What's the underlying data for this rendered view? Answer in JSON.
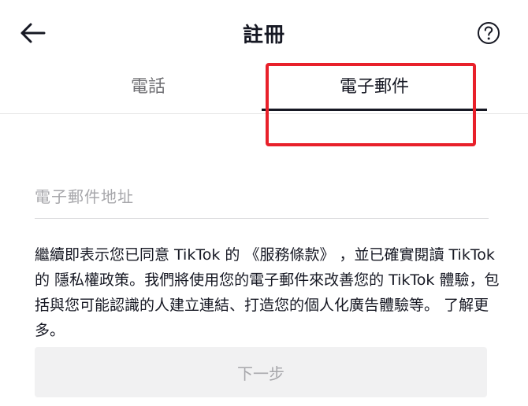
{
  "header": {
    "title": "註冊",
    "back_icon": "arrow-left-icon",
    "help_icon": "question-circle-icon"
  },
  "tabs": [
    {
      "label": "電話",
      "active": false
    },
    {
      "label": "電子郵件",
      "active": true
    }
  ],
  "email": {
    "placeholder": "電子郵件地址",
    "value": ""
  },
  "terms": {
    "part1": "繼續即表示您已同意 TikTok 的 ",
    "terms_link": "《服務條款》",
    "part2": " ，並已確實閱讀 TikTok 的 ",
    "privacy_link": "隱私權政策",
    "part3": "。我們將使用您的電子郵件來改善您的 TikTok 體驗，包括與您可能認識的人建立連結、打造您的個人化廣告體驗等。",
    "learn_more": "了解更多",
    "end": "。"
  },
  "next_button": {
    "label": "下一步",
    "enabled": false
  },
  "colors": {
    "highlight": "#e8202a",
    "text": "#161823",
    "muted": "#a7a7ab",
    "button_bg": "#f1f1f2"
  }
}
